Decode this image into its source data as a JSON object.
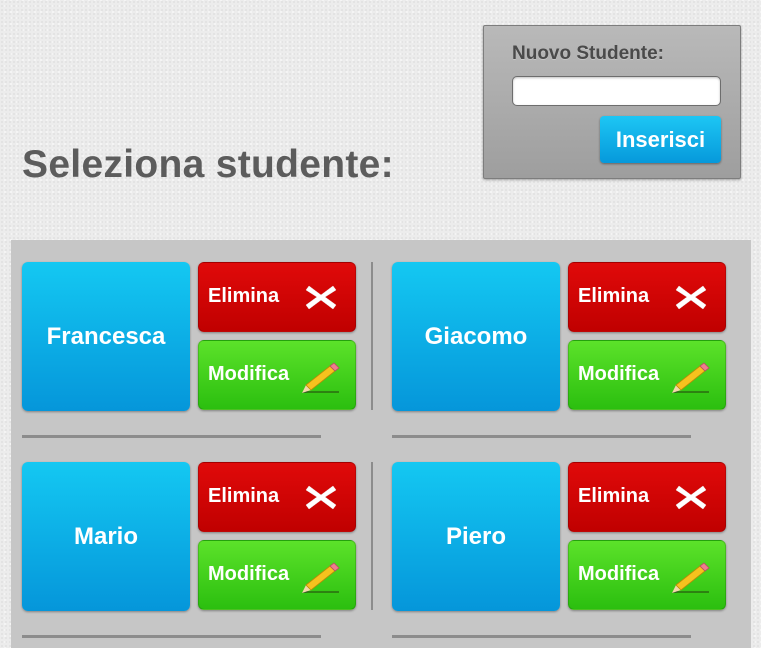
{
  "new_student": {
    "label": "Nuovo Studente:",
    "input_value": "",
    "input_placeholder": "",
    "button_label": "Inserisci"
  },
  "title": "Seleziona studente:",
  "students": [
    {
      "name": "Francesca",
      "delete_label": "Elimina",
      "edit_label": "Modifica"
    },
    {
      "name": "Giacomo",
      "delete_label": "Elimina",
      "edit_label": "Modifica"
    },
    {
      "name": "Mario",
      "delete_label": "Elimina",
      "edit_label": "Modifica"
    },
    {
      "name": "Piero",
      "delete_label": "Elimina",
      "edit_label": "Modifica"
    }
  ],
  "icons": {
    "delete": "x-icon",
    "edit": "pencil-icon"
  },
  "colors": {
    "student_button": "#0aaee6",
    "delete_button": "#d40404",
    "edit_button": "#44d01c",
    "insert_button": "#12b2ec"
  }
}
